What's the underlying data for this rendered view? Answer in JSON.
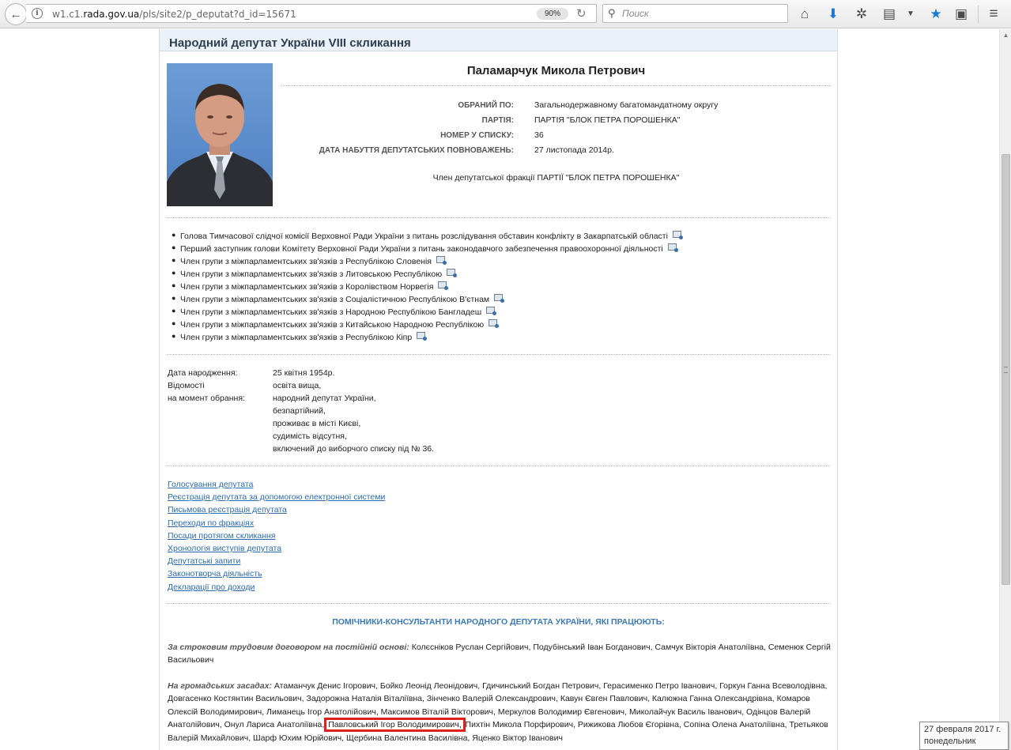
{
  "browser": {
    "url_prefix": "w1.c1.",
    "url_host": "rada.gov.ua",
    "url_path": "/pls/site2/p_deputat?d_id=15671",
    "zoom": "90%",
    "search_placeholder": "Поиск",
    "icons": [
      "home-icon",
      "download-icon",
      "extensions-icon",
      "reader-icon",
      "menu-dropdown-icon",
      "bookmark-star-icon",
      "clipboard-icon",
      "hamburger-menu-icon"
    ]
  },
  "page": {
    "title": "Народний депутат України VIII скликання",
    "deputy_name": "Паламарчук Микола Петрович",
    "info": [
      {
        "label": "ОБРАНИЙ ПО:",
        "value": "Загальнодержавному багатомандатному округу"
      },
      {
        "label": "ПАРТІЯ:",
        "value": "ПАРТІЯ \"БЛОК ПЕТРА ПОРОШЕНКА\""
      },
      {
        "label": "НОМЕР У СПИСКУ:",
        "value": "36"
      },
      {
        "label": "ДАТА НАБУТТЯ ДЕПУТАТСЬКИХ ПОВНОВАЖЕНЬ:",
        "value": "27 листопада 2014р."
      }
    ],
    "faction": "Член депутатської фракції ПАРТІЇ \"БЛОК ПЕТРА ПОРОШЕНКА\"",
    "posts": [
      "Голова Тимчасової слідчої комісії Верховної Ради України з питань розслідування обставин конфлікту в Закарпатській області",
      "Перший заступник голови Комітету Верховної Ради України з питань законодавчого забезпечення правоохоронної діяльності",
      "Член групи з міжпарламентських зв'язків з Республікою Словенія",
      "Член групи з міжпарламентських зв'язків з Литовською Республікою",
      "Член групи з міжпарламентських зв'язків з Королівством Норвегія",
      "Член групи з міжпарламентських зв'язків з Соціалістичною Республікою В'єтнам",
      "Член групи з міжпарламентських зв'язків з Народною Республікою Бангладеш",
      "Член групи з міжпарламентських зв'язків з Китайською Народною Республікою",
      "Член групи з міжпарламентських зв'язків з Республікою Кіпр"
    ],
    "bio": {
      "birth_label": "Дата народження:",
      "birth_value": "25 квітня 1954р.",
      "info_label_1": "Відомості",
      "info_label_2": "на момент обрання:",
      "info_lines": [
        "освіта вища,",
        "народний депутат України,",
        "безпартійний,",
        "проживає в місті Києві,",
        "судимість відсутня,",
        "включений до виборчого списку під № 36."
      ]
    },
    "links": [
      "Голосування депутата",
      "Реєстрація депутата за допомогою електронної системи",
      "Письмова реєстрація депутата",
      "Переходи по фракціях",
      "Посади протягом скликання",
      "Хронологія виступів депутата",
      "Депутатські запити",
      "Законотворча діяльність",
      "Декларації про доходи"
    ],
    "assistants_title": "ПОМІЧНИКИ-КОНСУЛЬТАНТИ НАРОДНОГО ДЕПУТАТА УКРАЇНИ, ЯКІ ПРАЦЮЮТЬ:",
    "contract_lead": "За строковим трудовим договором на постійній основі:",
    "contract_text": " Колєсніков Руслан Сергійович, Подубінський Іван Богданович, Самчук Вікторія Анатоліївна, Семенюк Сергій Васильович",
    "volunteer_lead": "На громадських засадах:",
    "volunteer_text_before": " Атаманчук Денис Ігорович, Бойко Леонід Леонідович, Гдичинський Богдан Петрович, Герасименко Петро Іванович, Горкун Ганна Всеволодівна, Довгасенко Костянтин Васильович, Задорожна Наталія Віталіївна, Зінченко Валерій Олександрович, Кавун Євген Павлович, Калюжна Ганна Олександрівна, Комаров Олексій Володимирович, Лиманець Ігор Анатолійович, Максимов Віталій Вікторович, Меркулов Володимир Євгенович, Миколайчук Василь Іванович, Одінцов Валерій Анатолійович, Онул Лариса Анатоліївна, ",
    "volunteer_highlight": "Павловський Ігор Володимирович,",
    "volunteer_text_after": " Пихтін Микола Порфирович, Рижикова Любов Єгорівна, Сопіна Олена Анатоліївна, Третьяков Валерій Михайлович, Шарф Юхим Юрійович, Щербина Валентина Василівна, Яценко Віктор Іванович"
  },
  "clock": {
    "date": "27 февраля 2017 г.",
    "weekday": "понедельник"
  }
}
